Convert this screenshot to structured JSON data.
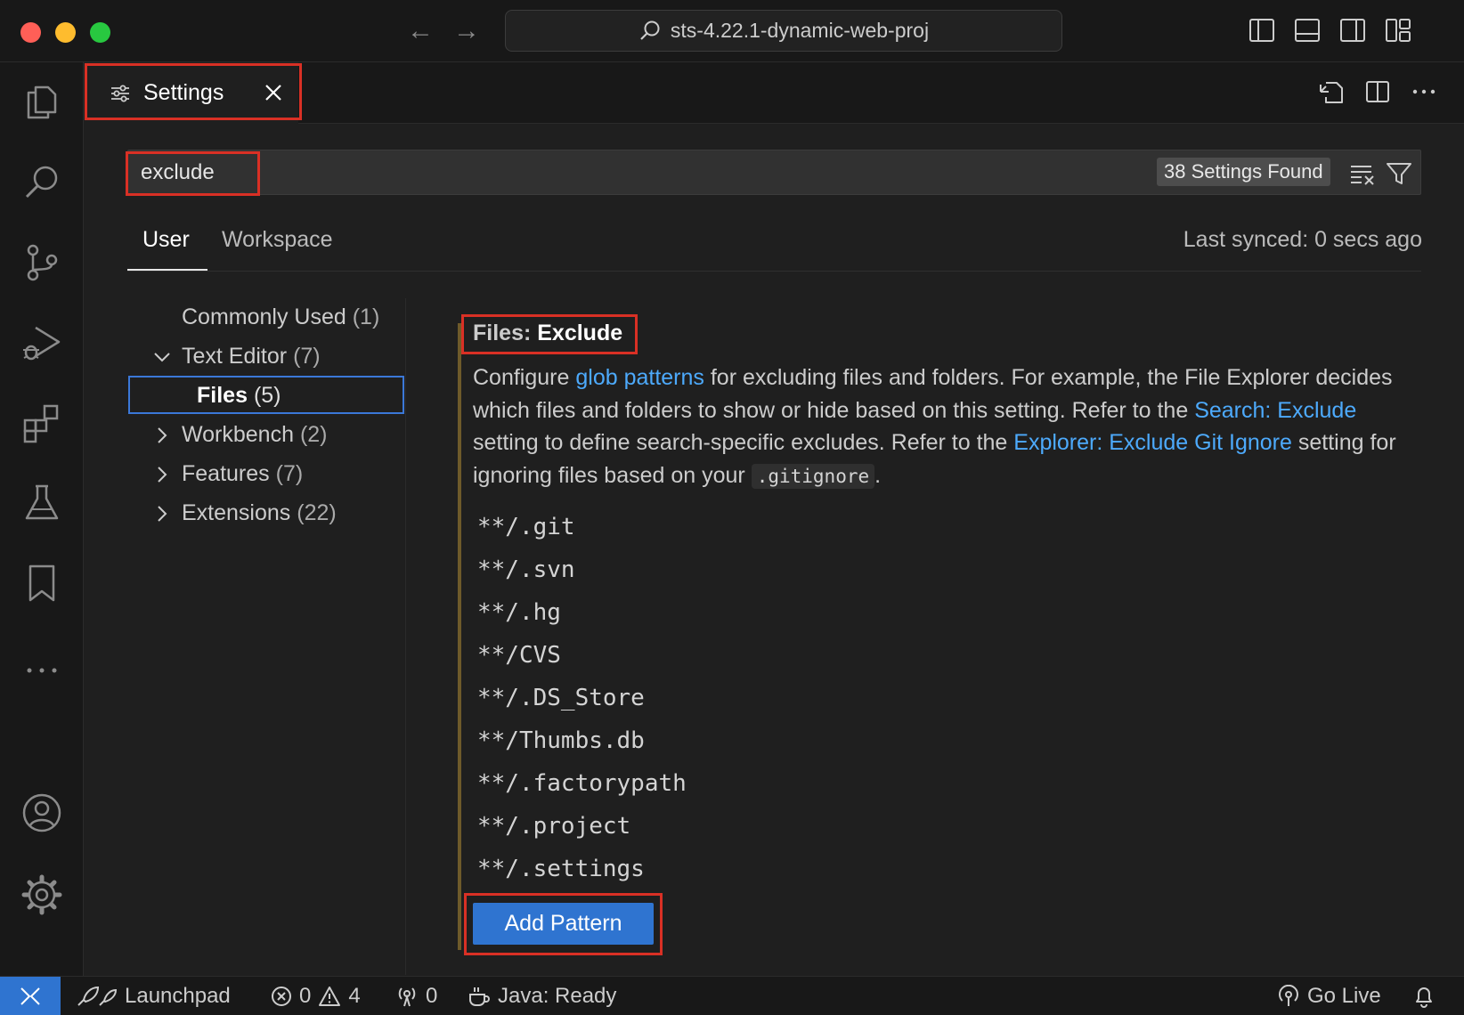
{
  "window": {
    "title": "sts-4.22.1-dynamic-web-proj",
    "nav_back": "←",
    "nav_forward": "→"
  },
  "activity_bar": {
    "items": [
      "explorer-icon",
      "search-icon",
      "source-control-icon",
      "run-debug-icon",
      "extensions-icon",
      "testing-icon",
      "bookmarks-icon",
      "more-icon"
    ],
    "bottom": [
      "accounts-icon",
      "manage-gear-icon"
    ]
  },
  "tab": {
    "label": "Settings",
    "close_glyph": "×"
  },
  "search": {
    "value": "exclude",
    "results_badge": "38 Settings Found"
  },
  "scope": {
    "user": "User",
    "workspace": "Workspace",
    "last_synced": "Last synced: 0 secs ago"
  },
  "toc": {
    "commonly_used": {
      "label": "Commonly Used",
      "count": "(1)"
    },
    "text_editor": {
      "label": "Text Editor",
      "count": "(7)"
    },
    "files": {
      "label": "Files",
      "count": "(5)"
    },
    "workbench": {
      "label": "Workbench",
      "count": "(2)"
    },
    "features": {
      "label": "Features",
      "count": "(7)"
    },
    "extensions": {
      "label": "Extensions",
      "count": "(22)"
    }
  },
  "setting": {
    "category": "Files: ",
    "name": "Exclude",
    "desc": {
      "t1": "Configure ",
      "link1": "glob patterns",
      "t2": " for excluding files and folders. For example, the File Explorer decides which files and folders to show or hide based on this setting. Refer to the ",
      "link2": "Search: Exclude",
      "t3": " setting to define search-specific excludes. Refer to the ",
      "link3": "Explorer: Exclude Git Ignore",
      "t4": " setting for ignoring files based on your ",
      "code": ".gitignore",
      "t5": "."
    },
    "patterns": [
      "**/.git",
      "**/.svn",
      "**/.hg",
      "**/CVS",
      "**/.DS_Store",
      "**/Thumbs.db",
      "**/.factorypath",
      "**/.project",
      "**/.settings"
    ],
    "add_button": "Add Pattern"
  },
  "statusbar": {
    "launchpad": "Launchpad",
    "errors": "0",
    "warnings": "4",
    "ports": "0",
    "java": "Java: Ready",
    "go_live": "Go Live"
  },
  "colors": {
    "accent": "#2f74d0",
    "link": "#4daafc",
    "highlight": "#d93025",
    "modified_bar": "#6e5a2a"
  }
}
